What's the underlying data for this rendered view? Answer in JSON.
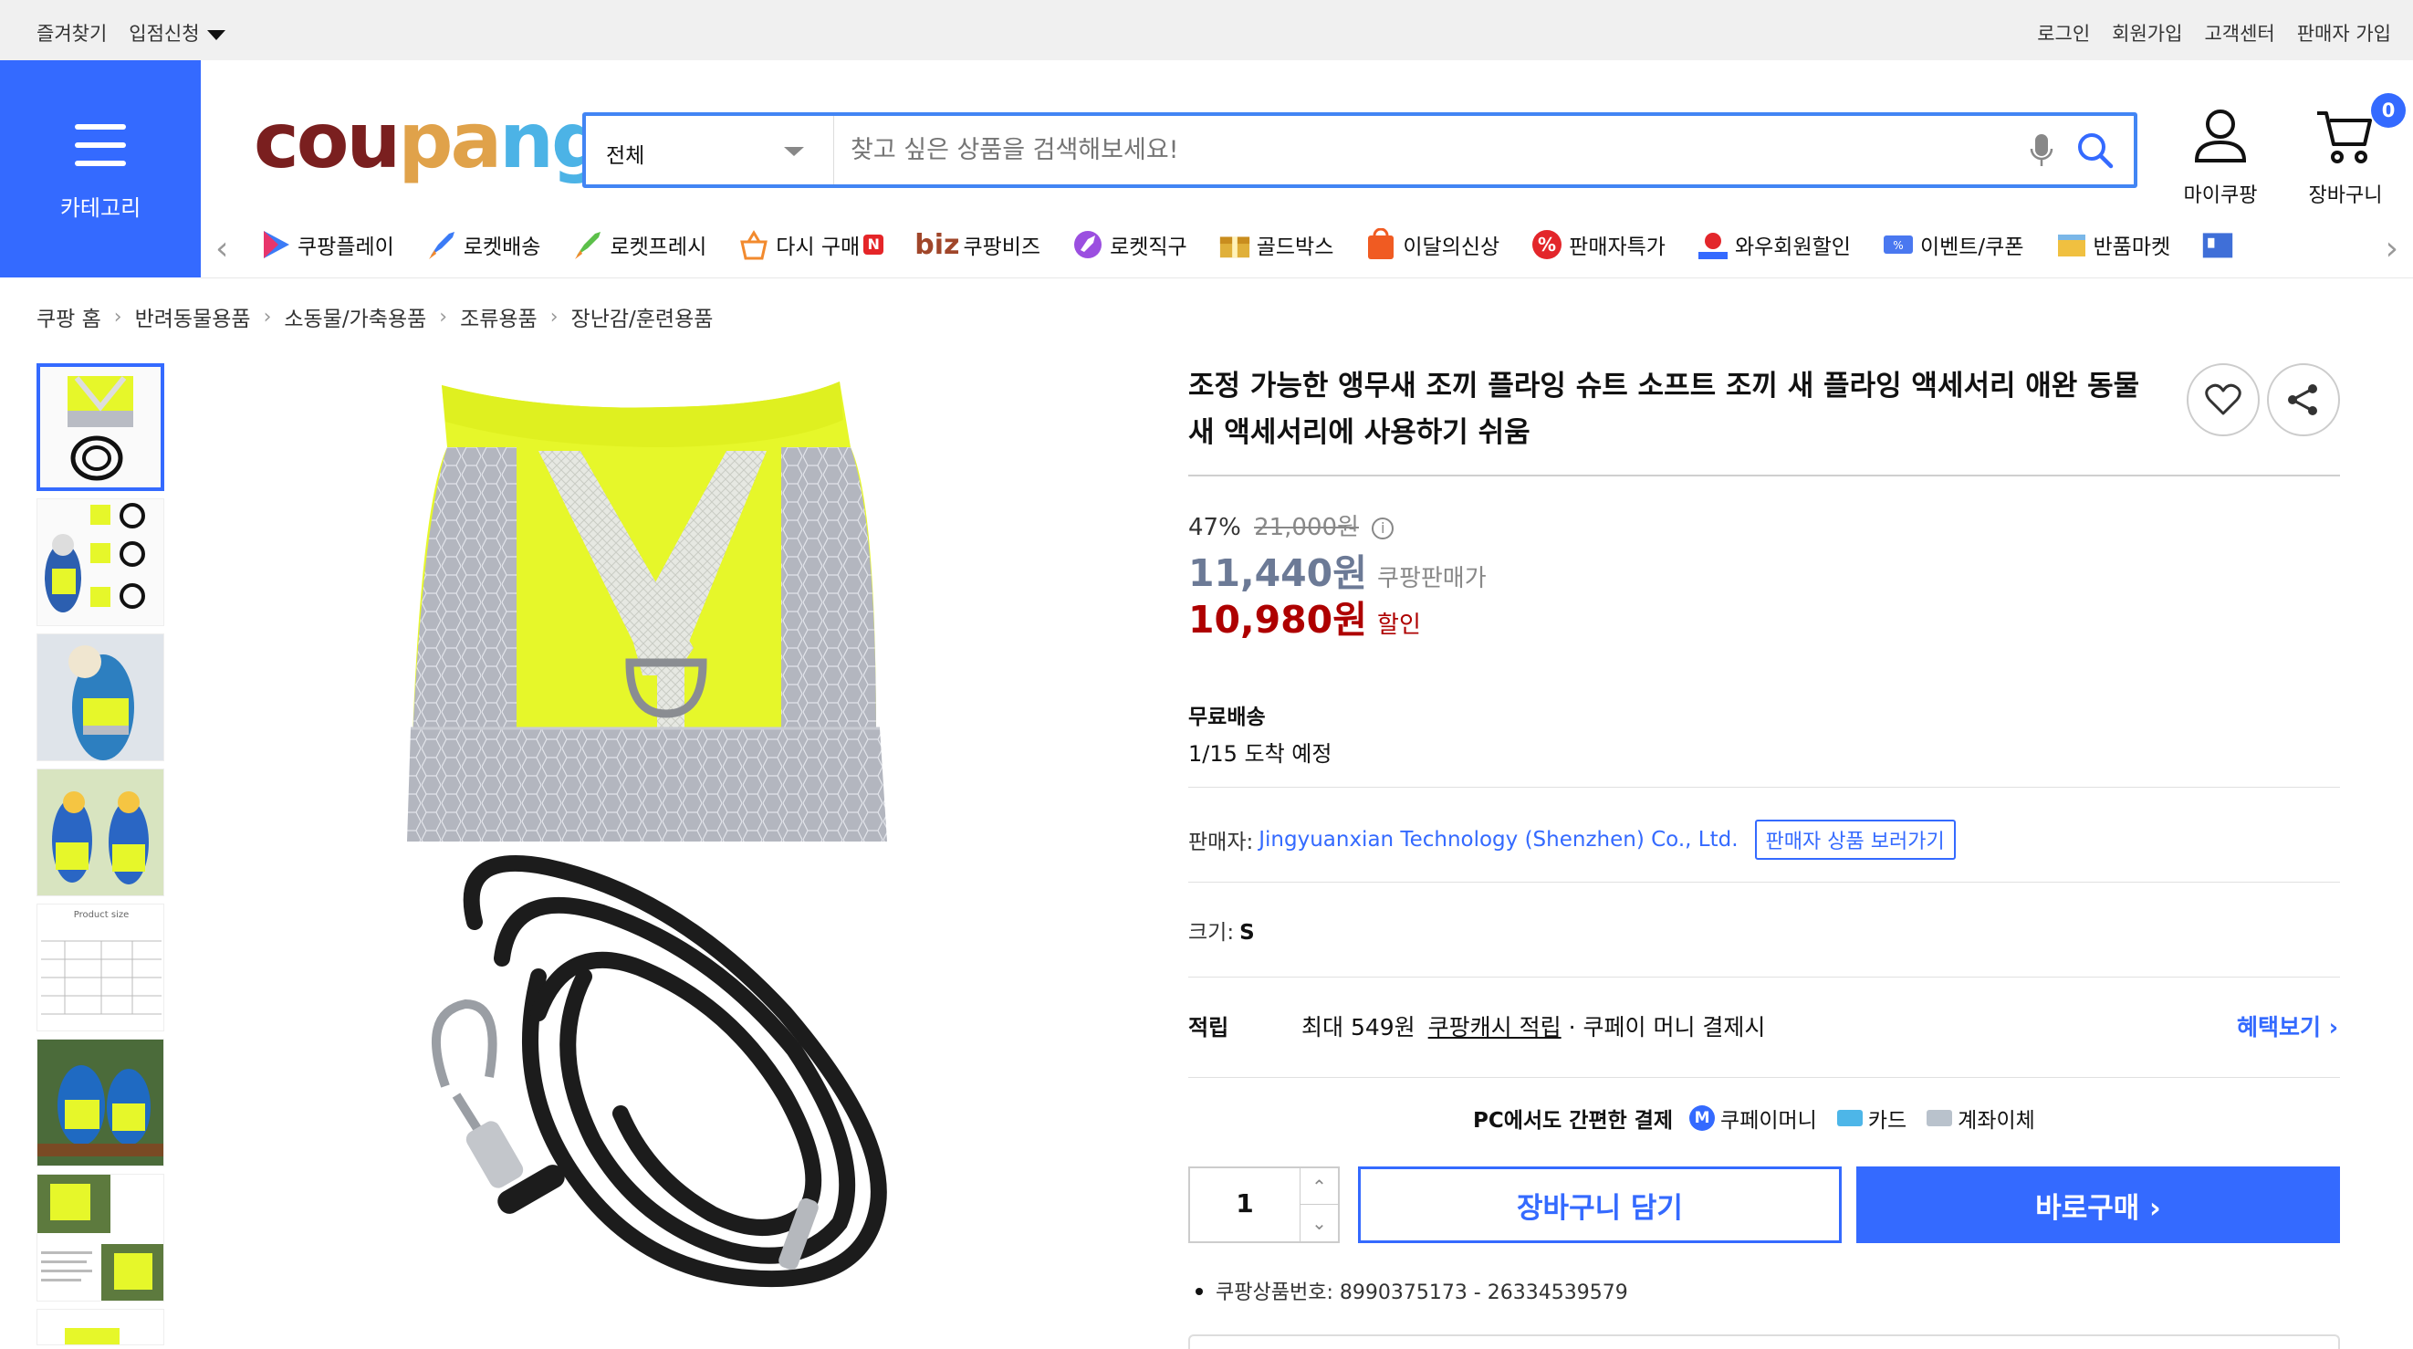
{
  "topbar": {
    "left": [
      "즐겨찾기",
      "입점신청"
    ],
    "right": [
      "로그인",
      "회원가입",
      "고객센터",
      "판매자 가입"
    ]
  },
  "category_label": "카테고리",
  "logo": {
    "text": "coupang",
    "letters": [
      "c",
      "o",
      "u",
      "p",
      "a",
      "n",
      "g"
    ],
    "colors": [
      "#7a1f1f",
      "#7a1f1f",
      "#7a1f1f",
      "#e0a24a",
      "#e0a24a",
      "#4cb3e6",
      "#4cb3e6"
    ]
  },
  "search": {
    "scope": "전체",
    "placeholder": "찾고 싶은 상품을 검색해보세요!"
  },
  "header": {
    "mycoupang": "마이쿠팡",
    "cart": "장바구니",
    "cart_count": "0"
  },
  "services": [
    {
      "label": "쿠팡플레이",
      "icon": "play-icon"
    },
    {
      "label": "로켓배송",
      "icon": "rocket-icon"
    },
    {
      "label": "로켓프레시",
      "icon": "rocket-fresh-icon"
    },
    {
      "label": "다시 구매",
      "icon": "rebuy-icon",
      "badge": "N"
    },
    {
      "label": "쿠팡비즈",
      "icon": "biz-icon",
      "prefix": "biz"
    },
    {
      "label": "로켓직구",
      "icon": "global-icon"
    },
    {
      "label": "골드박스",
      "icon": "goldbox-icon"
    },
    {
      "label": "이달의신상",
      "icon": "new-icon"
    },
    {
      "label": "판매자특가",
      "icon": "percent-icon"
    },
    {
      "label": "와우회원할인",
      "icon": "wow-icon"
    },
    {
      "label": "이벤트/쿠폰",
      "icon": "coupon-icon"
    },
    {
      "label": "반품마켓",
      "icon": "return-market-icon"
    }
  ],
  "breadcrumb": [
    "쿠팡 홈",
    "반려동물용품",
    "소동물/가축용품",
    "조류용품",
    "장난감/훈련용품"
  ],
  "product": {
    "title": "조정 가능한 앵무새 조끼 플라잉 슈트 소프트 조끼 새 플라잉 액세서리 애완 동물 새 액세서리에 사용하기 쉬움",
    "discount_rate": "47%",
    "original_price": "21,000원",
    "coupang_price": "11,440원",
    "coupang_price_label": "쿠팡판매가",
    "sale_price": "10,980원",
    "sale_price_label": "할인",
    "shipping_title": "무료배송",
    "arrival": "1/15 도착 예정",
    "seller_label": "판매자:",
    "seller_name": "Jingyuanxian Technology (Shenzhen) Co., Ltd.",
    "seller_button": "판매자 상품 보러가기",
    "size_label": "크기:",
    "size_value": "S",
    "reward_label": "적립",
    "reward_amount": "최대 549원",
    "reward_link": "쿠팡캐시 적립",
    "reward_suffix": "· 쿠페이 머니 결제시",
    "benefit_link": "혜택보기 ›",
    "pay_heading": "PC에서도 간편한 결제",
    "pay_methods": [
      "쿠페이머니",
      "카드",
      "계좌이체"
    ],
    "quantity": "1",
    "add_to_cart": "장바구니 담기",
    "buy_now": "바로구매 ›",
    "product_number": "쿠팡상품번호: 8990375173 - 26334539579"
  },
  "thumbnail_caption": "Product size",
  "colors": {
    "accent": "#346aff",
    "sale": "#ae0000",
    "vest": "#e6f72a"
  }
}
